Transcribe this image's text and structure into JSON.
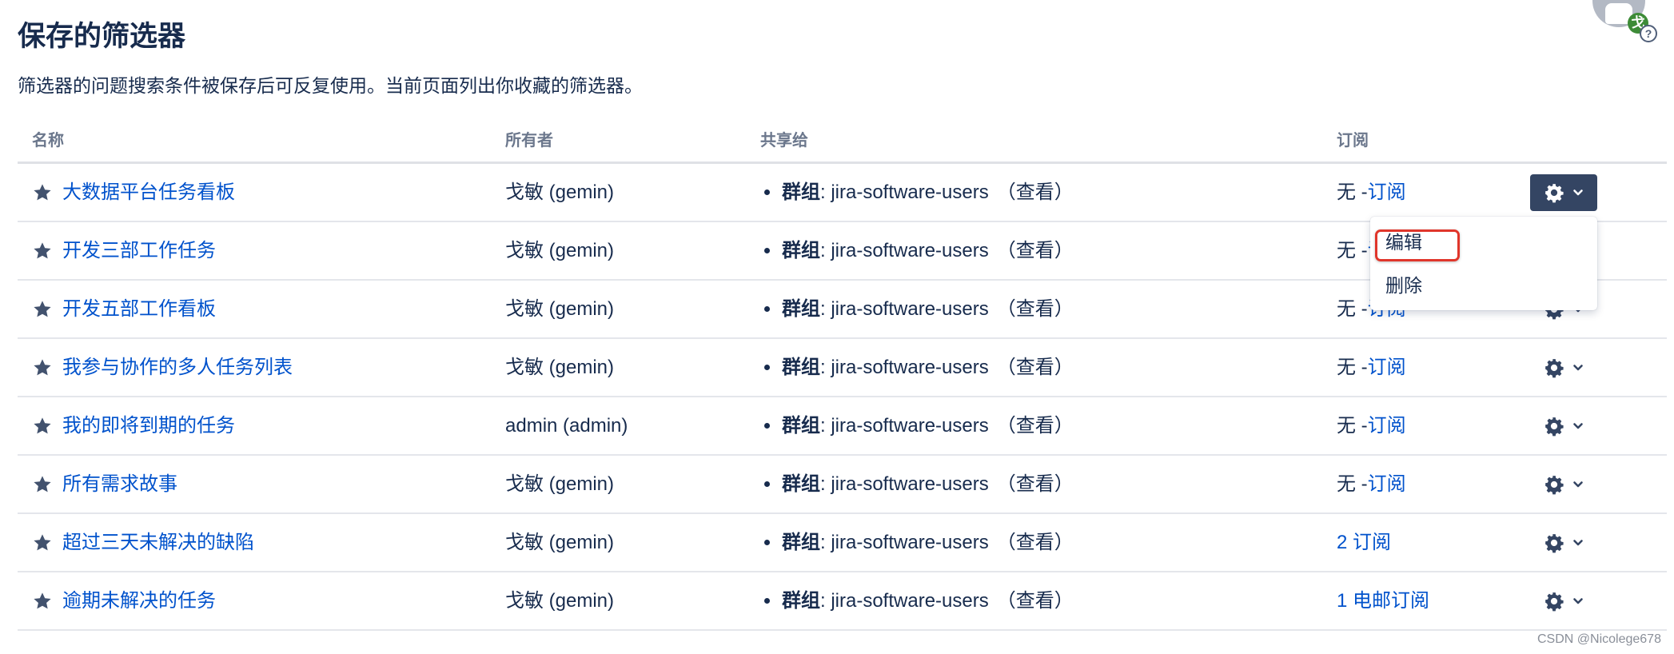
{
  "page": {
    "title": "保存的筛选器",
    "description": "筛选器的问题搜索条件被保存后可反复使用。当前页面列出你收藏的筛选器。"
  },
  "user": {
    "avatar_icon": "user-avatar-icon",
    "presence_initial": "戈",
    "help_glyph": "?"
  },
  "table": {
    "headers": {
      "name": "名称",
      "owner": "所有者",
      "shared": "共享给",
      "subscriptions": "订阅"
    },
    "rows": [
      {
        "name": "大数据平台任务看板",
        "owner": "戈敏 (gemin)",
        "share_type": "群组",
        "share_target": ": jira-software-users",
        "share_permission": "（查看）",
        "sub_prefix": "无 - ",
        "sub_link": "订阅",
        "starred": true
      },
      {
        "name": "开发三部工作任务",
        "owner": "戈敏 (gemin)",
        "share_type": "群组",
        "share_target": ": jira-software-users",
        "share_permission": "（查看）",
        "sub_prefix": "无 - ",
        "sub_link": "订阅",
        "starred": true
      },
      {
        "name": "开发五部工作看板",
        "owner": "戈敏 (gemin)",
        "share_type": "群组",
        "share_target": ": jira-software-users",
        "share_permission": "（查看）",
        "sub_prefix": "无 - ",
        "sub_link": "订阅",
        "starred": true
      },
      {
        "name": "我参与协作的多人任务列表",
        "owner": "戈敏 (gemin)",
        "share_type": "群组",
        "share_target": ": jira-software-users",
        "share_permission": "（查看）",
        "sub_prefix": "无 - ",
        "sub_link": "订阅",
        "starred": true
      },
      {
        "name": "我的即将到期的任务",
        "owner": "admin (admin)",
        "share_type": "群组",
        "share_target": ": jira-software-users",
        "share_permission": "（查看）",
        "sub_prefix": "无 - ",
        "sub_link": "订阅",
        "starred": true
      },
      {
        "name": "所有需求故事",
        "owner": "戈敏 (gemin)",
        "share_type": "群组",
        "share_target": ": jira-software-users",
        "share_permission": "（查看）",
        "sub_prefix": "无 - ",
        "sub_link": "订阅",
        "starred": true
      },
      {
        "name": "超过三天未解决的缺陷",
        "owner": "戈敏 (gemin)",
        "share_type": "群组",
        "share_target": ": jira-software-users",
        "share_permission": "（查看）",
        "sub_prefix": "",
        "sub_link": "2 订阅",
        "starred": true
      },
      {
        "name": "逾期未解决的任务",
        "owner": "戈敏 (gemin)",
        "share_type": "群组",
        "share_target": ": jira-software-users",
        "share_permission": "（查看）",
        "sub_prefix": "",
        "sub_link": "1 电邮订阅",
        "starred": true
      }
    ]
  },
  "actions_menu": {
    "open_row": 0,
    "items": [
      {
        "label": "编辑",
        "highlighted": true
      },
      {
        "label": "删除",
        "highlighted": false
      }
    ]
  },
  "icons": {
    "star": "star-icon",
    "gear": "gear-icon",
    "chevron": "chevron-down-icon"
  },
  "colors": {
    "link": "#0052CC",
    "text": "#172B4D",
    "header_text": "#6B778C",
    "active_button": "#344563",
    "highlight_box": "#E0362B",
    "presence_badge": "#3D8B37"
  },
  "watermark": "CSDN @Nicolege678"
}
